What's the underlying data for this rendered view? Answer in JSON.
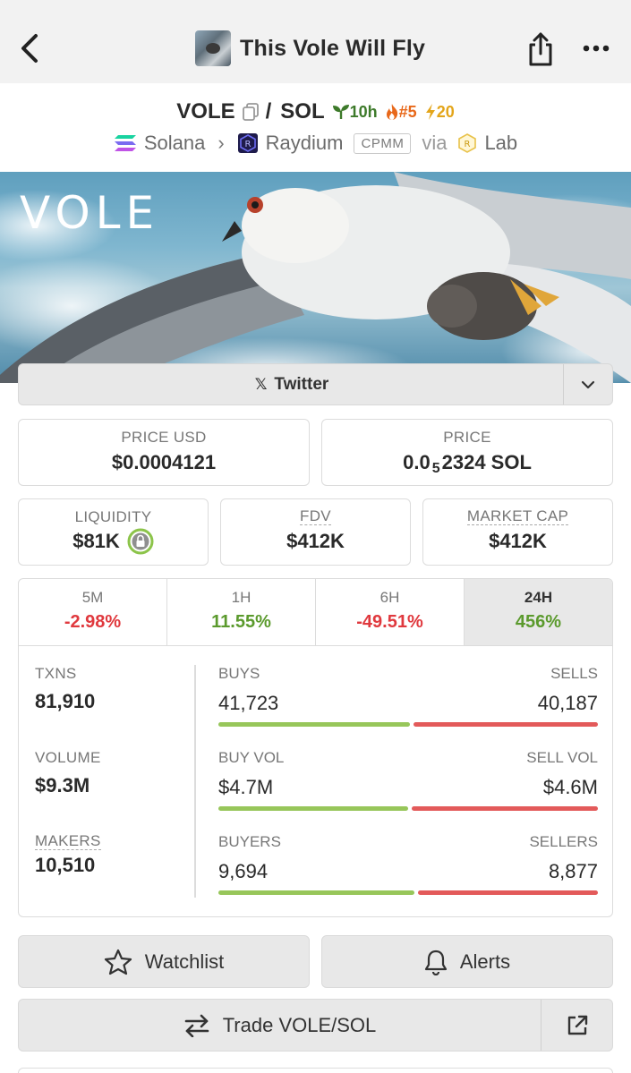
{
  "header": {
    "title": "This Vole Will Fly"
  },
  "pair": {
    "base": "VOLE",
    "slash": "/",
    "quote": "SOL",
    "age": "10h",
    "rank": "#5",
    "boosts": "20"
  },
  "chain": {
    "chain": "Solana",
    "dex": "Raydium",
    "pool_type": "CPMM",
    "via_label": "via",
    "via_dex": "Lab"
  },
  "banner": {
    "text": "VOLE"
  },
  "social": {
    "label": "Twitter",
    "x_glyph": "𝕏"
  },
  "price": {
    "usd_label": "PRICE USD",
    "usd_value": "$0.0004121",
    "native_label": "PRICE",
    "native_prefix": "0.0",
    "native_zeros": "5",
    "native_suffix": "2324 SOL"
  },
  "metrics": {
    "liquidity_label": "LIQUIDITY",
    "liquidity_value": "$81K",
    "fdv_label": "FDV",
    "fdv_value": "$412K",
    "mcap_label": "MARKET CAP",
    "mcap_value": "$412K"
  },
  "timeframes": [
    {
      "label": "5M",
      "value": "-2.98%"
    },
    {
      "label": "1H",
      "value": "11.55%"
    },
    {
      "label": "6H",
      "value": "-49.51%"
    },
    {
      "label": "24H",
      "value": "456%"
    }
  ],
  "stats": {
    "txns_label": "TXNS",
    "txns": "81,910",
    "volume_label": "VOLUME",
    "volume": "$9.3M",
    "makers_label": "MAKERS",
    "makers": "10,510",
    "buys_label": "BUYS",
    "buys": "41,723",
    "sells_label": "SELLS",
    "sells": "40,187",
    "buyvol_label": "BUY VOL",
    "buyvol": "$4.7M",
    "sellvol_label": "SELL VOL",
    "sellvol": "$4.6M",
    "buyers_label": "BUYERS",
    "buyers": "9,694",
    "sellers_label": "SELLERS",
    "sellers": "8,877",
    "buy_ratio_txns": 0.509,
    "buy_ratio_vol": 0.505,
    "buy_ratio_makers": 0.522
  },
  "actions": {
    "watchlist": "Watchlist",
    "alerts": "Alerts",
    "trade": "Trade VOLE/SOL"
  },
  "colors": {
    "positive": "#5b9a2d",
    "negative": "#e0393e",
    "buy_bar": "#97c65a",
    "sell_bar": "#e35a5a"
  }
}
